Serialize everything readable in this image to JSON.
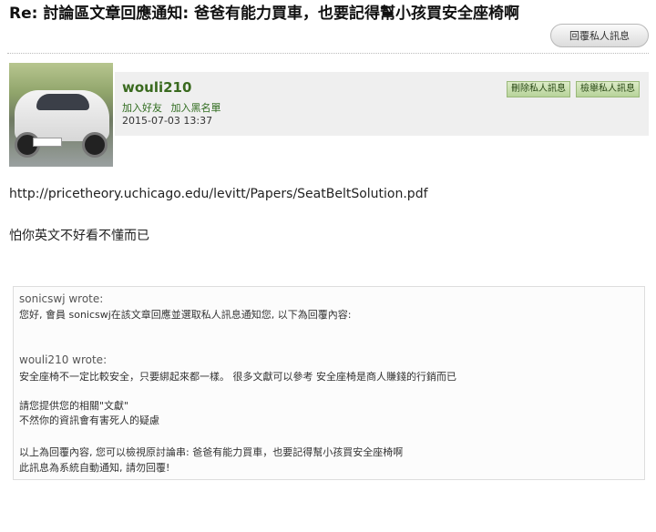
{
  "title": "Re: 討論區文章回應通知: 爸爸有能力買車，也要記得幫小孩買安全座椅啊",
  "reply_button": "回覆私人訊息",
  "user": {
    "name": "wouli210",
    "add_friend": "加入好友",
    "add_blacklist": "加入黑名單",
    "date": "2015-07-03 13:37"
  },
  "buttons": {
    "delete": "刪除私人訊息",
    "report": "檢舉私人訊息"
  },
  "message": {
    "link": "http://pricetheory.uchicago.edu/levitt/Papers/SeatBeltSolution.pdf",
    "line2": "怕你英文不好看不懂而已"
  },
  "quote": {
    "name1": "sonicswj wrote:",
    "line1": "您好, 會員 sonicswj在該文章回應並選取私人訊息通知您, 以下為回覆內容:",
    "name2": "wouli210 wrote:",
    "line2": "安全座椅不一定比較安全，只要綁起來都一樣。 很多文獻可以參考 安全座椅是商人賺錢的行銷而已",
    "line3": "請您提供您的相關\"文獻\"",
    "line4": "不然你的資訊會有害死人的疑慮",
    "line5": "以上為回覆內容, 您可以檢視原討論串: 爸爸有能力買車，也要記得幫小孩買安全座椅啊",
    "line6": "此訊息為系統自動通知, 請勿回覆!"
  }
}
